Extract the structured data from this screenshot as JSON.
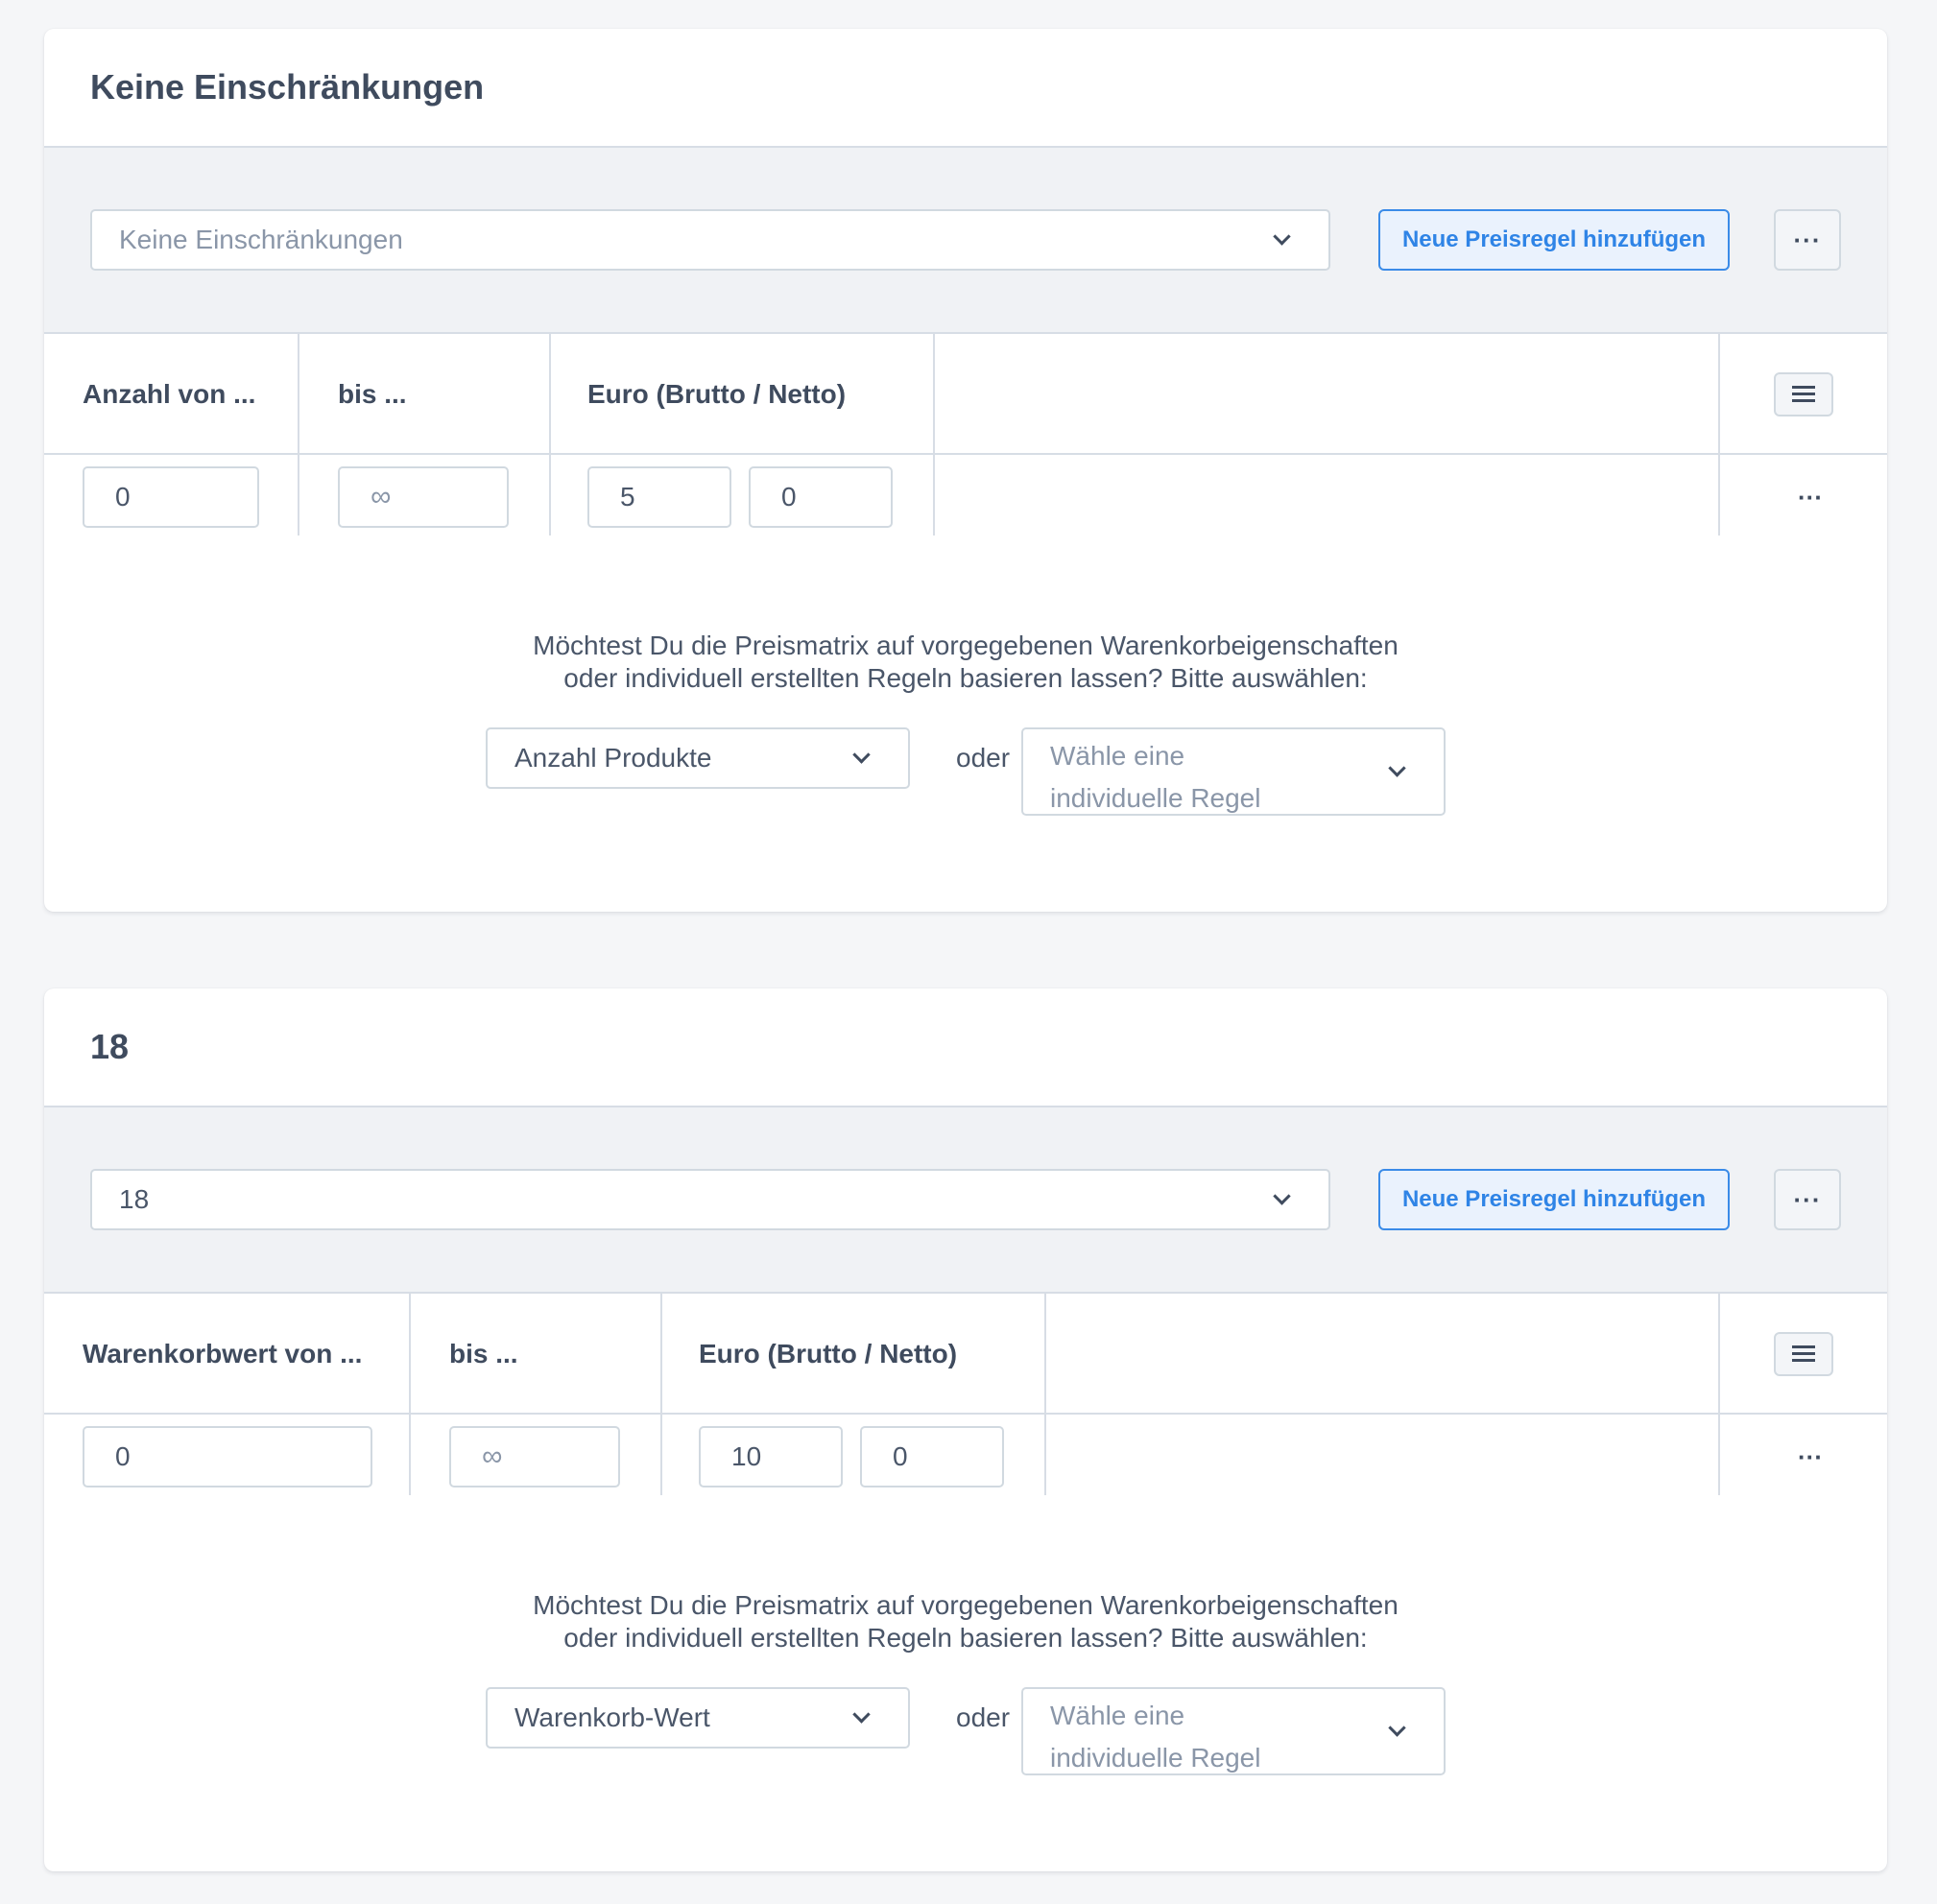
{
  "cards": [
    {
      "title": "Keine Einschränkungen",
      "restriction_select": {
        "value": "Keine Einschränkungen",
        "is_placeholder": true
      },
      "add_rule_button": "Neue Preisregel hinzufügen",
      "more_label": "···",
      "columns": [
        "Anzahl von ...",
        "bis ...",
        "Euro (Brutto / Netto)"
      ],
      "row": {
        "from": "0",
        "to": "∞",
        "gross": "5",
        "net": "0"
      },
      "question_line1": "Möchtest Du die Preismatrix auf vorgegebenen Warenkorbeigenschaften",
      "question_line2": "oder individuell erstellten Regeln basieren lassen? Bitte auswählen:",
      "property_select": "Anzahl Produkte",
      "or_label": "oder",
      "rule_select_placeholder_line1": "Wähle eine",
      "rule_select_placeholder_line2": "individuelle Regel"
    },
    {
      "title": "18",
      "restriction_select": {
        "value": "18",
        "is_placeholder": false
      },
      "add_rule_button": "Neue Preisregel hinzufügen",
      "more_label": "···",
      "columns": [
        "Warenkorbwert von ...",
        "bis ...",
        "Euro (Brutto / Netto)"
      ],
      "row": {
        "from": "0",
        "to": "∞",
        "gross": "10",
        "net": "0"
      },
      "question_line1": "Möchtest Du die Preismatrix auf vorgegebenen Warenkorbeigenschaften",
      "question_line2": "oder individuell erstellten Regeln basieren lassen? Bitte auswählen:",
      "property_select": "Warenkorb-Wert",
      "or_label": "oder",
      "rule_select_placeholder_line1": "Wähle eine",
      "rule_select_placeholder_line2": "individuelle Regel"
    }
  ],
  "colors": {
    "accent": "#2f84e6",
    "text": "#4a5669",
    "placeholder": "#8a96a8",
    "border": "#d1d9e0",
    "toolbar_bg": "#f0f2f5",
    "page_bg": "#f5f6f8"
  },
  "icons": {
    "chevron": "chevron-down-icon",
    "more": "more-horizontal-icon",
    "menu": "hamburger-menu-icon"
  }
}
